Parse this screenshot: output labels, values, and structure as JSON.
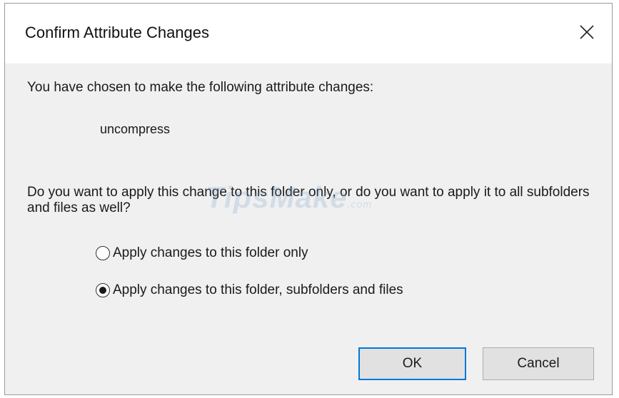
{
  "dialog": {
    "title": "Confirm Attribute Changes",
    "close_glyph": "✕"
  },
  "content": {
    "prompt": "You have chosen to make the following attribute changes:",
    "attribute": "uncompress",
    "question": "Do you want to apply this change to this folder only, or do you want to apply it to all subfolders and files as well?"
  },
  "options": [
    {
      "label": "Apply changes to this folder only",
      "selected": false
    },
    {
      "label": "Apply changes to this folder, subfolders and files",
      "selected": true
    }
  ],
  "buttons": {
    "ok_label": "OK",
    "cancel_label": "Cancel"
  },
  "watermark": {
    "text": "TipsMake",
    "suffix": ".com"
  },
  "colors": {
    "dialog_bg": "#f0f0f0",
    "titlebar_bg": "#ffffff",
    "default_button_border": "#0078d7",
    "button_bg": "#e1e1e1"
  },
  "icons": {
    "close": "close-icon",
    "radio_unchecked": "radio-unchecked-icon",
    "radio_checked": "radio-checked-icon"
  }
}
